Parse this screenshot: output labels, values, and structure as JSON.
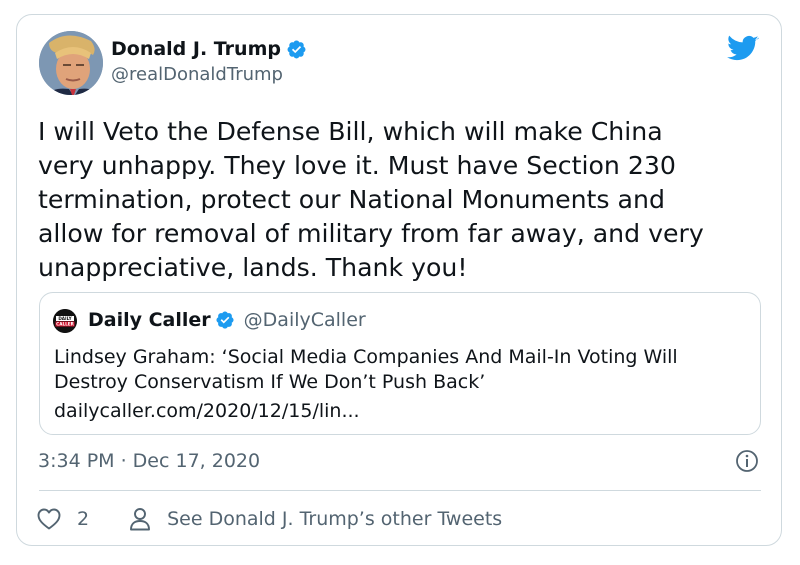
{
  "author": {
    "name": "Donald J. Trump",
    "handle": "@realDonaldTrump"
  },
  "tweet": {
    "text": "I will Veto the Defense Bill, which will make China\nvery unhappy. They love it. Must have Section 230\ntermination, protect our National Monuments and\nallow for removal of military from far away, and very\nunappreciative, lands. Thank you!"
  },
  "quoted_tweet": {
    "logo_text": [
      "DAILY",
      "CALLER"
    ],
    "name": "Daily Caller",
    "handle": "@DailyCaller",
    "text": "Lindsey Graham: ‘Social Media Companies And Mail-In Voting Will\nDestroy Conservatism If We Don’t Push Back’",
    "link": "dailycaller.com/2020/12/15/lin..."
  },
  "meta": {
    "timestamp": "3:34 PM · Dec 17, 2020"
  },
  "actions": {
    "like_count": "2",
    "other_tweets_label": "See Donald J. Trump’s other Tweets"
  },
  "colors": {
    "twitter_blue": "#1d9bf0",
    "secondary_text": "#536471",
    "border": "#cfd9de"
  },
  "icons": [
    "verified-badge-icon",
    "twitter-bird-icon",
    "info-icon",
    "heart-icon",
    "person-icon"
  ]
}
